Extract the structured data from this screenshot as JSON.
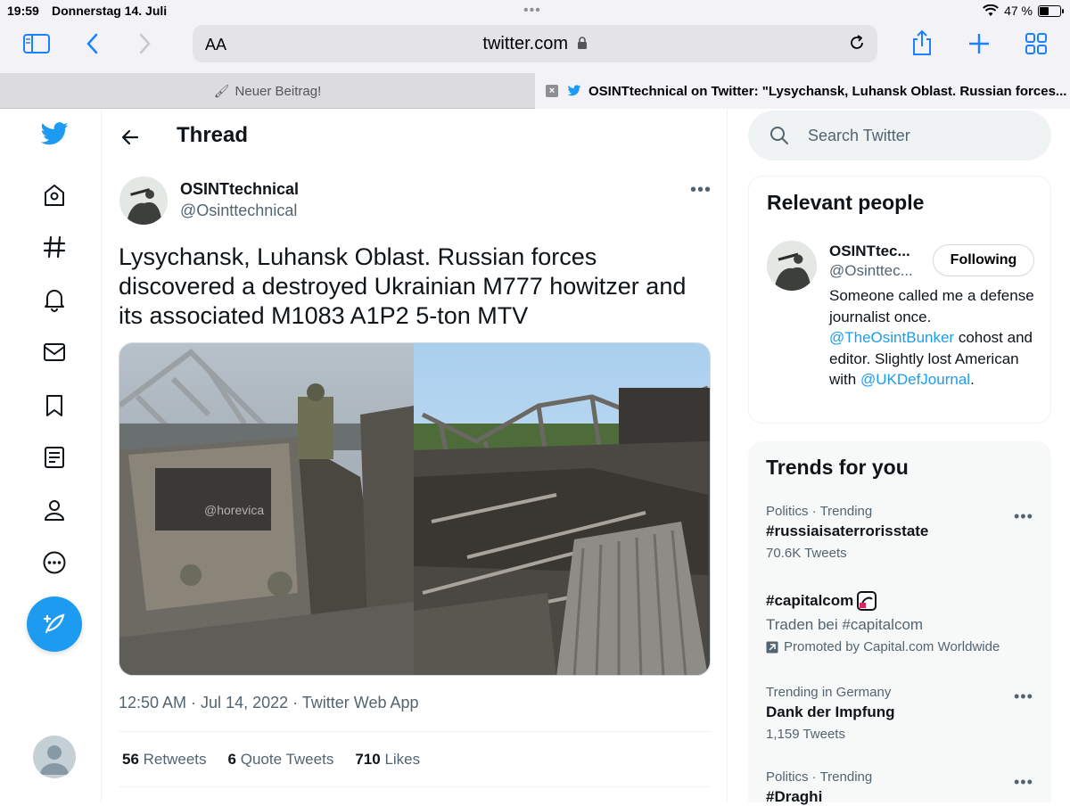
{
  "status_bar": {
    "time": "19:59",
    "date": "Donnerstag 14. Juli",
    "battery_pct": "47 %"
  },
  "browser": {
    "text_size_label": "AA",
    "url": "twitter.com",
    "tabs": [
      {
        "title": "Neuer Beitrag!",
        "active": false
      },
      {
        "title": "OSINTtechnical on Twitter: \"Lysychansk, Luhansk Oblast. Russian forces...",
        "active": true
      }
    ]
  },
  "nav": {
    "items": [
      "twitter-logo",
      "home",
      "explore",
      "notifications",
      "messages",
      "bookmarks",
      "lists",
      "profile",
      "more"
    ]
  },
  "thread": {
    "title": "Thread",
    "author_name": "OSINTtechnical",
    "author_handle": "@Osinttechnical",
    "text": "Lysychansk, Luhansk Oblast. Russian forces discovered a destroyed Ukrainian M777 howitzer and its associated M1083 A1P2 5-ton MTV",
    "image_watermark": "@horevica",
    "timestamp": "12:50 AM · Jul 14, 2022 · Twitter Web App",
    "stats": [
      {
        "count": "56",
        "label": "Retweets"
      },
      {
        "count": "6",
        "label": "Quote Tweets"
      },
      {
        "count": "710",
        "label": "Likes"
      }
    ]
  },
  "search": {
    "placeholder": "Search Twitter"
  },
  "relevant_people": {
    "heading": "Relevant people",
    "name": "OSINTtec...",
    "handle": "@Osinttec...",
    "follow_label": "Following",
    "bio_1": "Someone called me a defense journalist once. ",
    "bio_link_1": "@TheOsintBunker",
    "bio_2": " cohost and editor. Slightly lost American with ",
    "bio_link_2": "@UKDefJournal",
    "bio_3": "."
  },
  "trends": {
    "heading": "Trends for you",
    "items": [
      {
        "context": "Politics · Trending",
        "name": "#russiaisaterrorisstate",
        "count": "70.6K Tweets"
      },
      {
        "context": "",
        "name": "#capitalcom",
        "subtitle": "Traden bei #capitalcom",
        "promo": "Promoted by Capital.com Worldwide"
      },
      {
        "context": "Trending in Germany",
        "name": "Dank der Impfung",
        "count": "1,159 Tweets"
      },
      {
        "context": "Politics · Trending",
        "name": "#Draghi",
        "count": ""
      }
    ]
  },
  "colors": {
    "twitter_blue": "#1d9bf0",
    "safari_blue": "#1a82ff",
    "secondary_text": "#536471"
  }
}
